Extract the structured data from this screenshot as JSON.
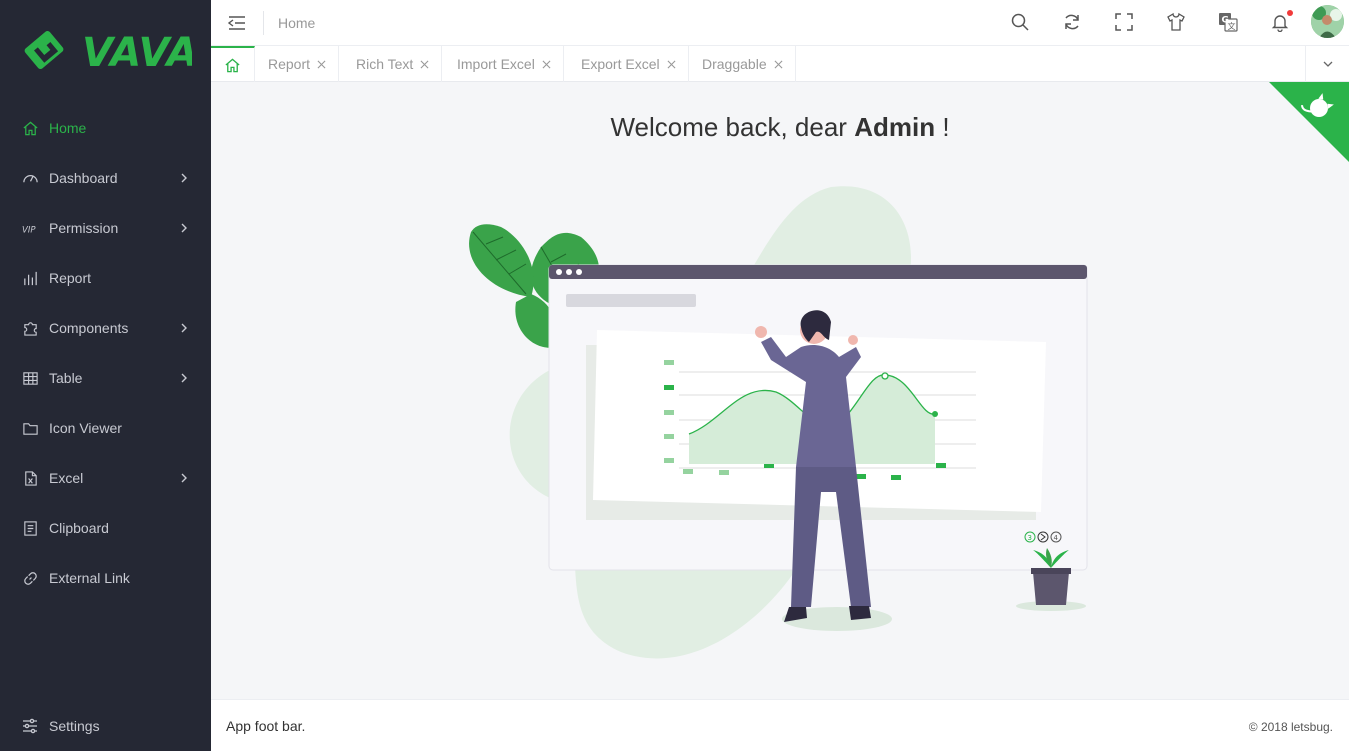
{
  "app": {
    "logo_text": "VAVA",
    "accent": "#2bb34a"
  },
  "sidebar": {
    "items": [
      {
        "label": "Home",
        "icon": "home-icon",
        "active": true,
        "submenu": false
      },
      {
        "label": "Dashboard",
        "icon": "dashboard-icon",
        "submenu": true
      },
      {
        "label": "Permission",
        "icon": "vip-icon",
        "submenu": true
      },
      {
        "label": "Report",
        "icon": "bar-chart-icon",
        "submenu": false
      },
      {
        "label": "Components",
        "icon": "puzzle-icon",
        "submenu": true
      },
      {
        "label": "Table",
        "icon": "table-icon",
        "submenu": true
      },
      {
        "label": "Icon Viewer",
        "icon": "folder-icon",
        "submenu": false
      },
      {
        "label": "Excel",
        "icon": "excel-icon",
        "submenu": true
      },
      {
        "label": "Clipboard",
        "icon": "clipboard-icon",
        "submenu": false
      },
      {
        "label": "External Link",
        "icon": "link-icon",
        "submenu": false
      }
    ],
    "settings_label": "Settings"
  },
  "header": {
    "breadcrumb": "Home",
    "icons": [
      "search-icon",
      "refresh-icon",
      "fullscreen-icon",
      "theme-shirt-icon",
      "translate-icon",
      "bell-icon"
    ]
  },
  "tabs": [
    {
      "label": "Report"
    },
    {
      "label": "Rich Text"
    },
    {
      "label": "Import Excel"
    },
    {
      "label": "Export Excel"
    },
    {
      "label": "Draggable"
    }
  ],
  "main": {
    "welcome_prefix": "Welcome back, dear",
    "welcome_name": "Admin",
    "welcome_suffix": "!",
    "pager_labels": [
      "3",
      "4"
    ]
  },
  "footer": {
    "left": "App foot bar.",
    "right": "© 2018 letsbug."
  }
}
